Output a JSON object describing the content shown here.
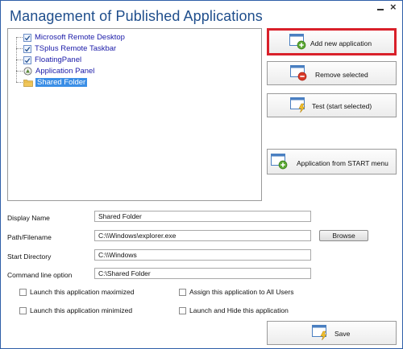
{
  "window": {
    "title": "Management of Published Applications",
    "close_glyph": "×"
  },
  "tree": {
    "items": [
      {
        "label": "Microsoft Remote Desktop",
        "icon": "checkbox-checked-icon",
        "selected": false
      },
      {
        "label": "TSplus Remote Taskbar",
        "icon": "checkbox-checked-icon",
        "selected": false
      },
      {
        "label": "FloatingPanel",
        "icon": "checkbox-checked-icon",
        "selected": false
      },
      {
        "label": "Application Panel",
        "icon": "application-panel-icon",
        "selected": false
      },
      {
        "label": "Shared Folder",
        "icon": "folder-icon",
        "selected": true
      }
    ]
  },
  "actions": {
    "add_label": "Add new application",
    "remove_label": "Remove selected",
    "test_label": "Test (start selected)",
    "start_menu_label": "Application from START menu",
    "highlight_color": "#d9202a"
  },
  "form": {
    "display_name_label": "Display Name",
    "display_name_value": "Shared Folder",
    "path_label": "Path/Filename",
    "path_value": "C:\\\\Windows\\explorer.exe",
    "browse_label": "Browse",
    "start_dir_label": "Start Directory",
    "start_dir_value": "C:\\\\Windows",
    "cmdline_label": "Command line option",
    "cmdline_value": "C:\\Shared Folder"
  },
  "options": {
    "launch_maximized": "Launch this application maximized",
    "launch_minimized": "Launch this application minimized",
    "assign_all_users": "Assign this application to All Users",
    "launch_hide": "Launch and Hide this application"
  },
  "save_label": "Save"
}
